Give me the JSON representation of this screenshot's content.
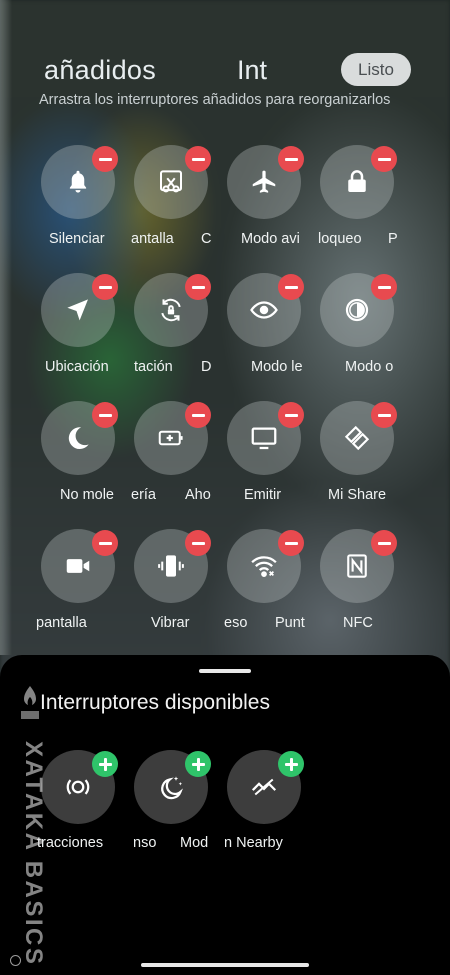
{
  "header": {
    "tab_added": "añadidos",
    "tab_int": "Int",
    "done_button": "Listo",
    "subtitle": "Arrastra los interruptores añadidos para reorganizarlos"
  },
  "added_labels": {
    "r1": [
      "Silenciar",
      "antalla",
      "C",
      "Modo avi",
      "loqueo",
      "P"
    ],
    "r2": [
      "Ubicación",
      "tación",
      "D",
      "Modo le",
      "Modo o"
    ],
    "r3": [
      "No mole",
      "ería",
      "Aho",
      "Emitir",
      "Mi Share"
    ],
    "r4": [
      " pantalla",
      "Vibrar",
      "eso",
      "Punt",
      "NFC"
    ]
  },
  "added_icons": [
    "bell-icon",
    "screenshot-icon",
    "airplane-icon",
    "lock-icon",
    "location-icon",
    "rotation-lock-icon",
    "eye-icon",
    "contrast-icon",
    "moon-icon",
    "battery-saver-icon",
    "cast-icon",
    "mi-share-icon",
    "video-icon",
    "vibrate-icon",
    "hotspot-icon",
    "nfc-icon"
  ],
  "panel": {
    "title": "Interruptores disponibles",
    "labels": [
      "tracciones",
      "nso",
      "Mod",
      "n Nearby"
    ],
    "icons": [
      "focus-icon",
      "sleep-icon",
      "nearby-share-icon"
    ]
  },
  "watermark": "XATAKA BASICS",
  "colors": {
    "remove_badge": "#e84a4f",
    "add_badge": "#2fc46a",
    "done_button_bg": "#d9dcdc",
    "panel_bg": "#000000"
  }
}
